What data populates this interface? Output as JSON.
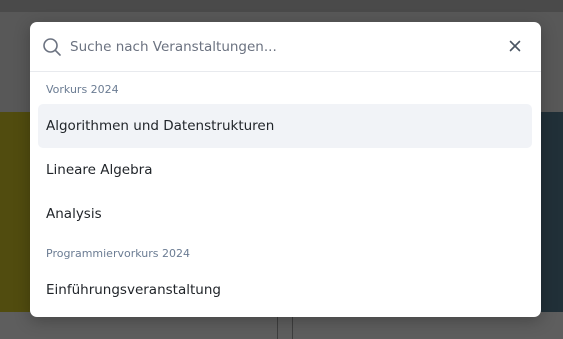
{
  "search": {
    "placeholder": "Suche nach Veranstaltungen..."
  },
  "groups": [
    {
      "label": "Vorkurs 2024",
      "items": [
        {
          "label": "Algorithmen und Datenstrukturen",
          "selected": true
        },
        {
          "label": "Lineare Algebra",
          "selected": false
        },
        {
          "label": "Analysis",
          "selected": false
        }
      ]
    },
    {
      "label": "Programmiervorkurs 2024",
      "items": [
        {
          "label": "Einführungsveranstaltung",
          "selected": false
        }
      ]
    }
  ],
  "icons": {
    "search": "search-icon",
    "close": "close-icon"
  },
  "colors": {
    "selected_bg": "#f1f3f7",
    "group_label": "#6b7c93",
    "left_card": "#514c0f",
    "right_card": "#213038"
  }
}
